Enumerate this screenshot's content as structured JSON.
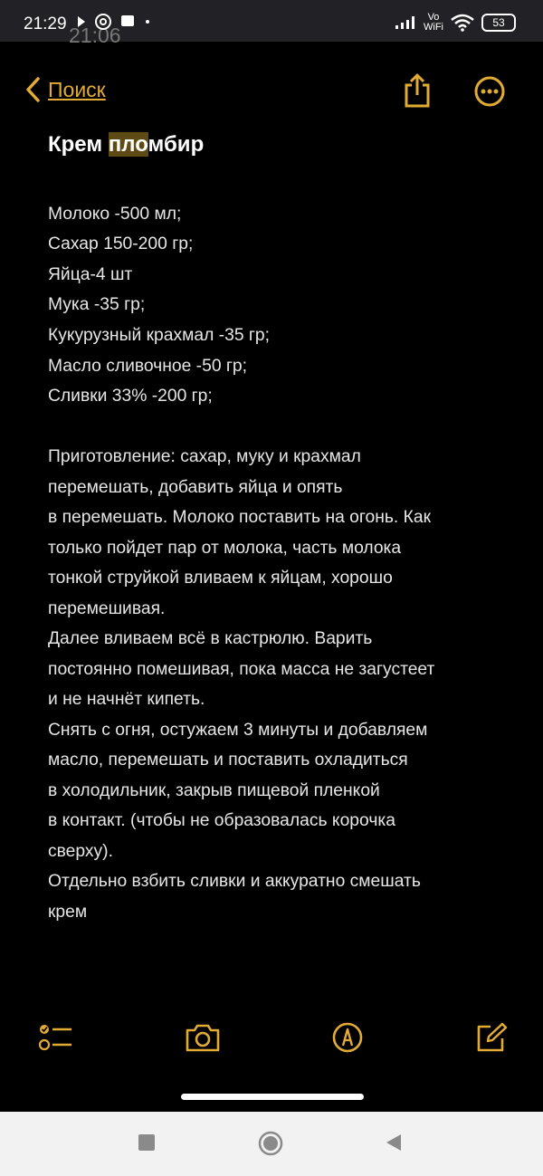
{
  "status_bar": {
    "time": "21:29",
    "overlay_time": "21:06",
    "network_label_top": "Vo",
    "network_label_bottom": "WiFi",
    "battery": "53"
  },
  "header": {
    "back_label": "Поиск",
    "accent_color": "#e2ac34"
  },
  "note": {
    "title_before": "Крем ",
    "title_highlight": "пло",
    "title_after": "мбир",
    "lines": [
      "Молоко -500 мл;",
      "Сахар 150-200 гр;",
      "Яйца-4 шт",
      "Мука -35 гр;",
      "Кукурузный крахмал -35 гр;",
      "Масло сливочное -50 гр;",
      "Сливки 33% -200 гр;",
      "",
      "Приготовление: сахар, муку и крахмал",
      "перемешать, добавить яйца и опять",
      "в перемешать. Молоко поставить на огонь. Как",
      "только пойдет пар от молока, часть молока",
      "тонкой струйкой вливаем к яйцам, хорошо",
      "перемешивая.",
      "Далее вливаем всё в кастрюлю. Варить",
      "постоянно помешивая, пока масса не загустеет",
      "и не начнёт кипеть.",
      "Снять с огня, остужаем 3 минуты  и добавляем",
      "масло, перемешать и поставить охладиться",
      "в холодильник, закрыв пищевой пленкой",
      "в контакт. (чтобы не образовалась корочка",
      "сверху).",
      "Отдельно взбить сливки и аккуратно смешать",
      "крем"
    ]
  },
  "icons": {
    "back": "chevron-left-icon",
    "share": "share-icon",
    "more": "more-icon",
    "checklist": "checklist-icon",
    "camera": "camera-icon",
    "markup": "markup-icon",
    "compose": "compose-icon"
  }
}
